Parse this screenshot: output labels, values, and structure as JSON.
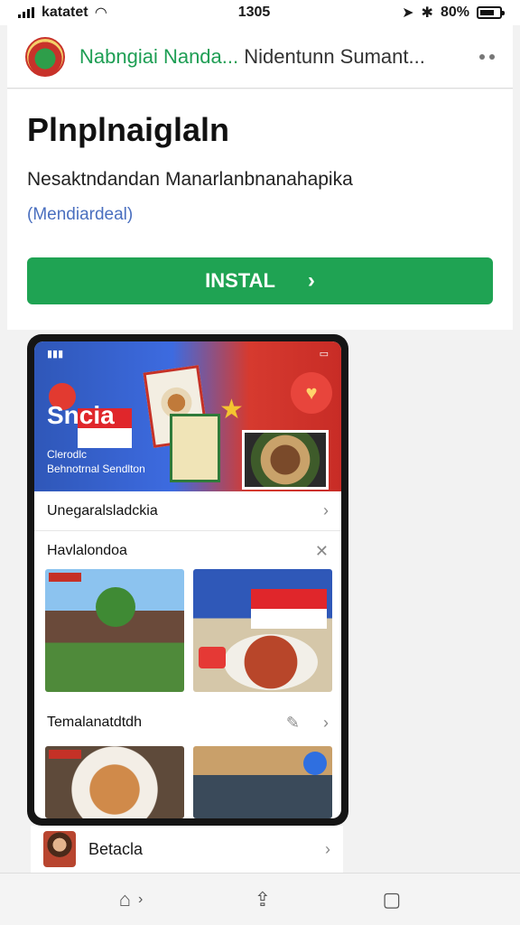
{
  "status_bar": {
    "carrier": "katatet",
    "time": "1305",
    "battery": "80%"
  },
  "header": {
    "site_host": "Nabngiai Nanda...",
    "site_rest": "Nidentunn Sumant...",
    "more_icon": "more-icon"
  },
  "app": {
    "title": "Plnplnaiglaln",
    "subtitle": "Nesaktndandan Manarlanbnanahapika",
    "link": "(Mendiardeal)",
    "install_label": "INSTAL",
    "install_chevron": "›",
    "accent": "#1fa353"
  },
  "preview": {
    "banner_title": "Sncia",
    "banner_caption_1": "Clerodlc",
    "banner_caption_2": "Behnotrnal Sendlton",
    "row1_label": "Unegaralsladckia",
    "row2_label": "Havlalondoa",
    "row3_label": "Temalanatdtdh",
    "chevron": "›",
    "close": "✕",
    "pin": "✎"
  },
  "card": {
    "label": "Betacla",
    "chevron": "›"
  },
  "bottom_nav": {
    "home_icon": "⌂",
    "home_chevron": "›",
    "share_icon": "⇪",
    "tabs_icon": "▢"
  }
}
